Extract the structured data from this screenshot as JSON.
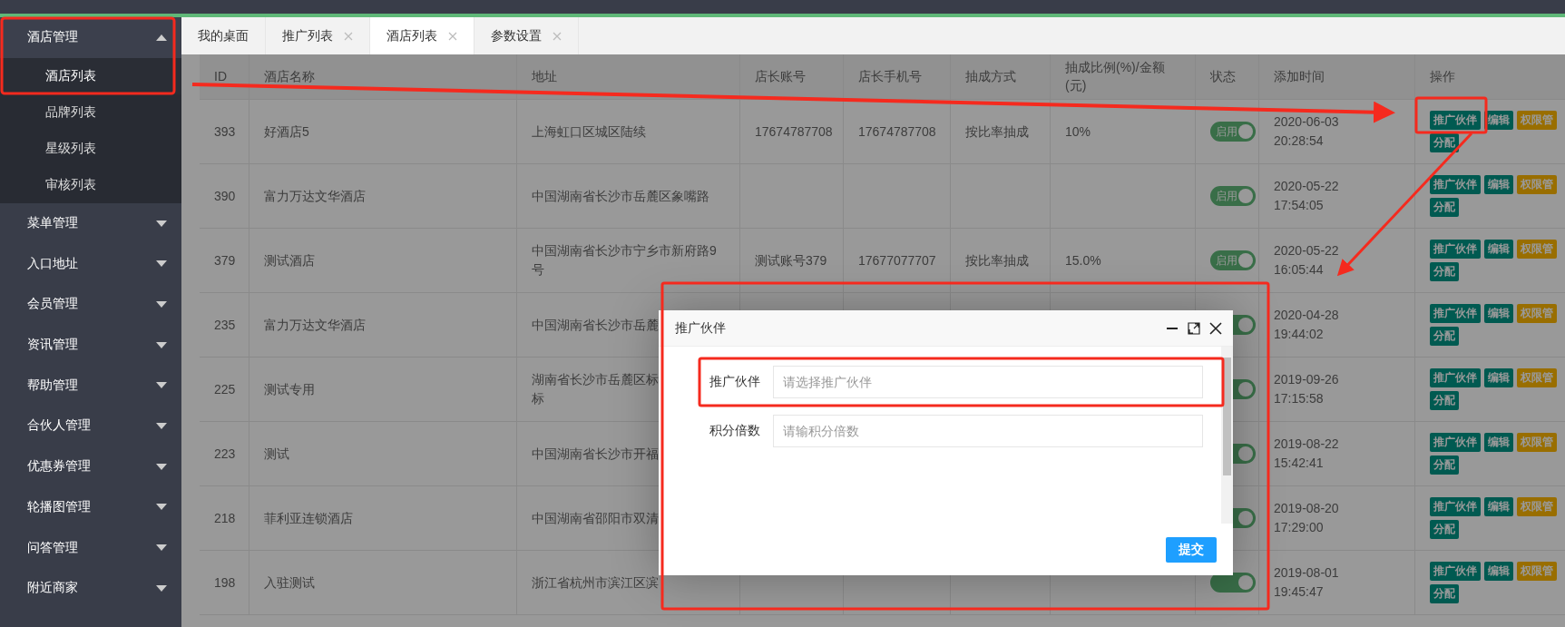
{
  "sidebar": {
    "items": [
      {
        "label": "酒店管理",
        "expanded": true,
        "children": [
          {
            "label": "酒店列表",
            "selected": true
          },
          {
            "label": "品牌列表",
            "selected": false
          },
          {
            "label": "星级列表",
            "selected": false
          },
          {
            "label": "审核列表",
            "selected": false
          }
        ]
      },
      {
        "label": "菜单管理",
        "expanded": false
      },
      {
        "label": "入口地址",
        "expanded": false
      },
      {
        "label": "会员管理",
        "expanded": false
      },
      {
        "label": "资讯管理",
        "expanded": false
      },
      {
        "label": "帮助管理",
        "expanded": false
      },
      {
        "label": "合伙人管理",
        "expanded": false
      },
      {
        "label": "优惠券管理",
        "expanded": false
      },
      {
        "label": "轮播图管理",
        "expanded": false
      },
      {
        "label": "问答管理",
        "expanded": false
      },
      {
        "label": "附近商家",
        "expanded": false
      }
    ]
  },
  "tabs": [
    {
      "label": "我的桌面",
      "selected": false,
      "closable": false
    },
    {
      "label": "推广列表",
      "selected": false,
      "closable": true
    },
    {
      "label": "酒店列表",
      "selected": true,
      "closable": true
    },
    {
      "label": "参数设置",
      "selected": false,
      "closable": true
    }
  ],
  "table": {
    "columns": [
      "ID",
      "酒店名称",
      "地址",
      "店长账号",
      "店长手机号",
      "抽成方式",
      "抽成比例(%)/金额(元)",
      "状态",
      "添加时间",
      "操作"
    ],
    "rows": [
      {
        "id": "393",
        "name": "好酒店5",
        "address": [
          "上海虹口区城区陆续"
        ],
        "account": "17674787708",
        "phone": "17674787708",
        "method": "按比率抽成",
        "ratio": "10%",
        "status": {
          "label": "启用",
          "on": true
        },
        "date": "2020-06-03",
        "time": "20:28:54",
        "actions": [
          {
            "label": "推广伙伴",
            "kind": "primary"
          },
          {
            "label": "编辑",
            "kind": "primary"
          },
          {
            "label": "权限管",
            "kind": "warning"
          },
          {
            "label": "分配",
            "kind": "primary"
          }
        ]
      },
      {
        "id": "390",
        "name": "富力万达文华酒店",
        "address": [
          "中国湖南省长沙市岳麓区象嘴路"
        ],
        "status": {
          "label": "启用",
          "on": true
        },
        "date": "2020-05-22",
        "time": "17:54:05",
        "actions": [
          {
            "label": "推广伙伴",
            "kind": "primary"
          },
          {
            "label": "编辑",
            "kind": "primary"
          },
          {
            "label": "权限管",
            "kind": "warning"
          },
          {
            "label": "分配",
            "kind": "primary"
          }
        ]
      },
      {
        "id": "379",
        "name": "测试酒店",
        "address": [
          "中国湖南省长沙市宁乡市新府路9号"
        ],
        "account": "测试账号379",
        "phone": "17677077707",
        "method": "按比率抽成",
        "ratio": "15.0%",
        "status": {
          "label": "启用",
          "on": true
        },
        "date": "2020-05-22",
        "time": "16:05:44",
        "actions": [
          {
            "label": "推广伙伴",
            "kind": "primary"
          },
          {
            "label": "编辑",
            "kind": "primary"
          },
          {
            "label": "权限管",
            "kind": "warning"
          },
          {
            "label": "分配",
            "kind": "primary"
          }
        ]
      },
      {
        "id": "235",
        "name": "富力万达文华酒店",
        "address": [
          "中国湖南省长沙市岳麓"
        ],
        "status": {
          "on": true
        },
        "date": "2020-04-28",
        "time": "19:44:02",
        "actions": [
          {
            "label": "推广伙伴",
            "kind": "primary"
          },
          {
            "label": "编辑",
            "kind": "primary"
          },
          {
            "label": "权限管",
            "kind": "warning"
          },
          {
            "label": "分配",
            "kind": "primary"
          }
        ]
      },
      {
        "id": "225",
        "name": "测试专用",
        "address": [
          "湖南省长沙市岳麓区标",
          "标"
        ],
        "status": {
          "on": true
        },
        "date": "2019-09-26",
        "time": "17:15:58",
        "actions": [
          {
            "label": "推广伙伴",
            "kind": "primary"
          },
          {
            "label": "编辑",
            "kind": "primary"
          },
          {
            "label": "权限管",
            "kind": "warning"
          },
          {
            "label": "分配",
            "kind": "primary"
          }
        ]
      },
      {
        "id": "223",
        "name": "测试",
        "address": [
          "中国湖南省长沙市开福"
        ],
        "status": {
          "on": true
        },
        "date": "2019-08-22",
        "time": "15:42:41",
        "actions": [
          {
            "label": "推广伙伴",
            "kind": "primary"
          },
          {
            "label": "编辑",
            "kind": "primary"
          },
          {
            "label": "权限管",
            "kind": "warning"
          },
          {
            "label": "分配",
            "kind": "primary"
          }
        ]
      },
      {
        "id": "218",
        "name": "菲利亚连锁酒店",
        "address": [
          "中国湖南省邵阳市双清"
        ],
        "status": {
          "on": true
        },
        "date": "2019-08-20",
        "time": "17:29:00",
        "actions": [
          {
            "label": "推广伙伴",
            "kind": "primary"
          },
          {
            "label": "编辑",
            "kind": "primary"
          },
          {
            "label": "权限管",
            "kind": "warning"
          },
          {
            "label": "分配",
            "kind": "primary"
          }
        ]
      },
      {
        "id": "198",
        "name": "入驻测试",
        "address": [
          "浙江省杭州市滨江区滨"
        ],
        "status": {
          "on": true
        },
        "date": "2019-08-01",
        "time": "19:45:47",
        "actions": [
          {
            "label": "推广伙伴",
            "kind": "primary"
          },
          {
            "label": "编辑",
            "kind": "primary"
          },
          {
            "label": "权限管",
            "kind": "warning"
          },
          {
            "label": "分配",
            "kind": "primary"
          }
        ]
      }
    ]
  },
  "dialog": {
    "title": "推广伙伴",
    "fields": [
      {
        "label": "推广伙伴",
        "placeholder": "请选择推广伙伴"
      },
      {
        "label": "积分倍数",
        "placeholder": "请输积分倍数"
      }
    ],
    "submit": "提交"
  }
}
